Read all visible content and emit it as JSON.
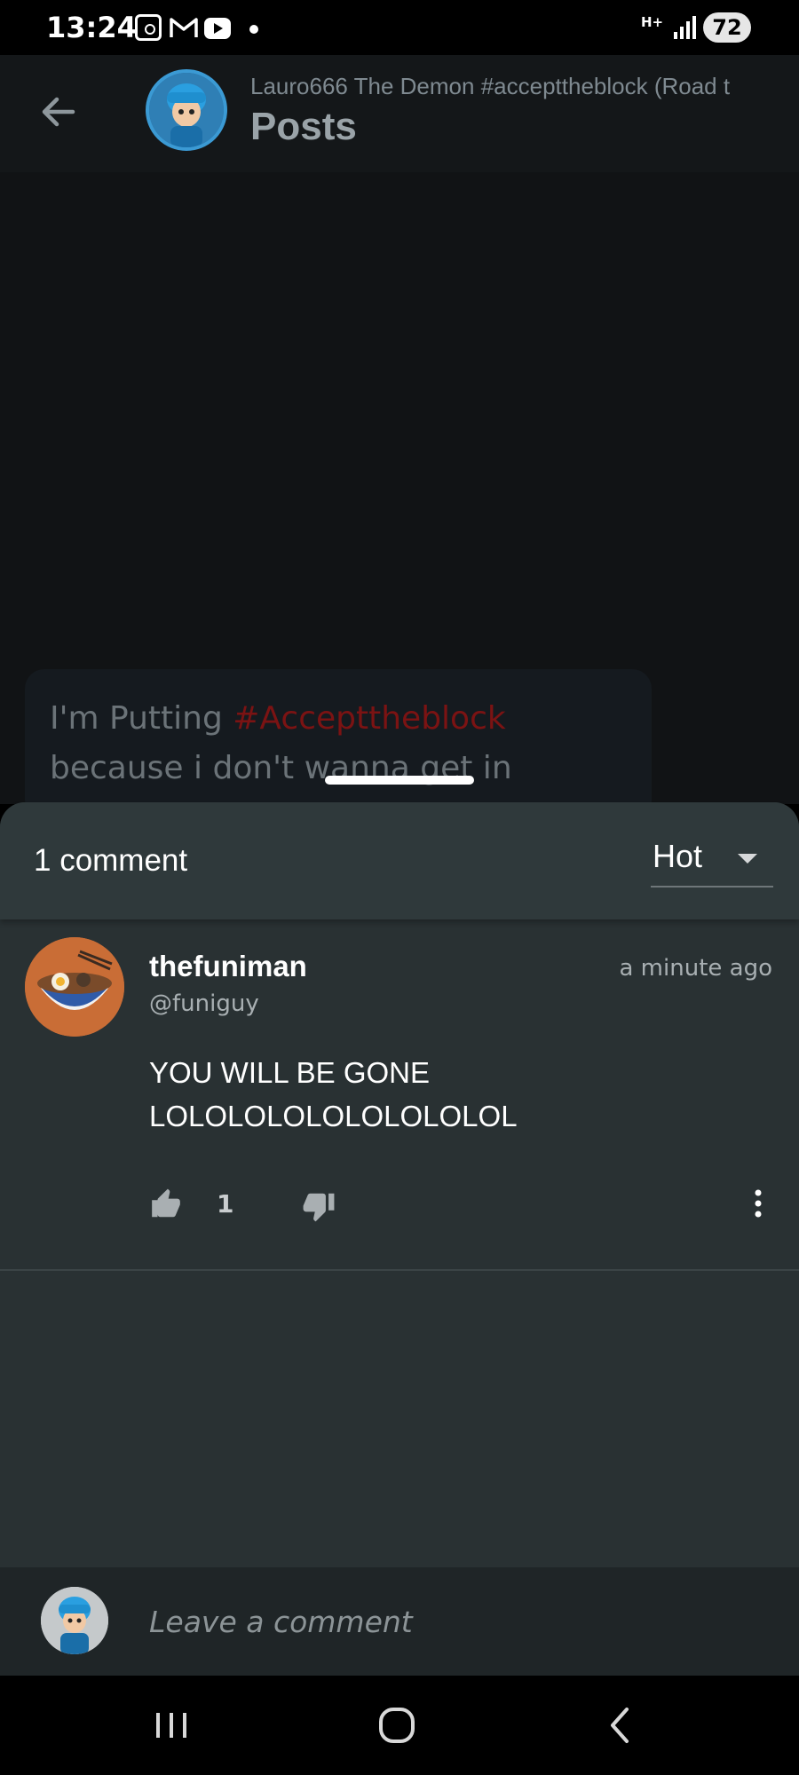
{
  "status_bar": {
    "time": "13:24",
    "network": "H+",
    "battery": "72"
  },
  "header": {
    "subtitle": "Lauro666 The Demon #accepttheblock (Road t",
    "title": "Posts"
  },
  "post": {
    "text_before": "I'm Putting ",
    "hashtag": "#Accepttheblock",
    "text_after": " because i don't wanna get in"
  },
  "comments": {
    "count_label": "1 comment",
    "sort_value": "Hot",
    "items": [
      {
        "name": "thefuniman",
        "handle": "@funiguy",
        "time": "a minute ago",
        "body_line1": "YOU WILL BE GONE",
        "body_line2": "LOLOLOLOLOLOLOLOLOL",
        "likes": "1"
      }
    ]
  },
  "input": {
    "placeholder": "Leave a comment"
  },
  "colors": {
    "hashtag": "#7b1313",
    "sheet": "#293133",
    "sheet_header": "#2f393b",
    "input_bar": "#1f2527"
  },
  "icons": [
    "back-arrow-icon",
    "thumb-up-icon",
    "thumb-down-icon",
    "more-vertical-icon",
    "chevron-down-icon",
    "recent-apps-icon",
    "home-icon",
    "nav-back-icon"
  ]
}
